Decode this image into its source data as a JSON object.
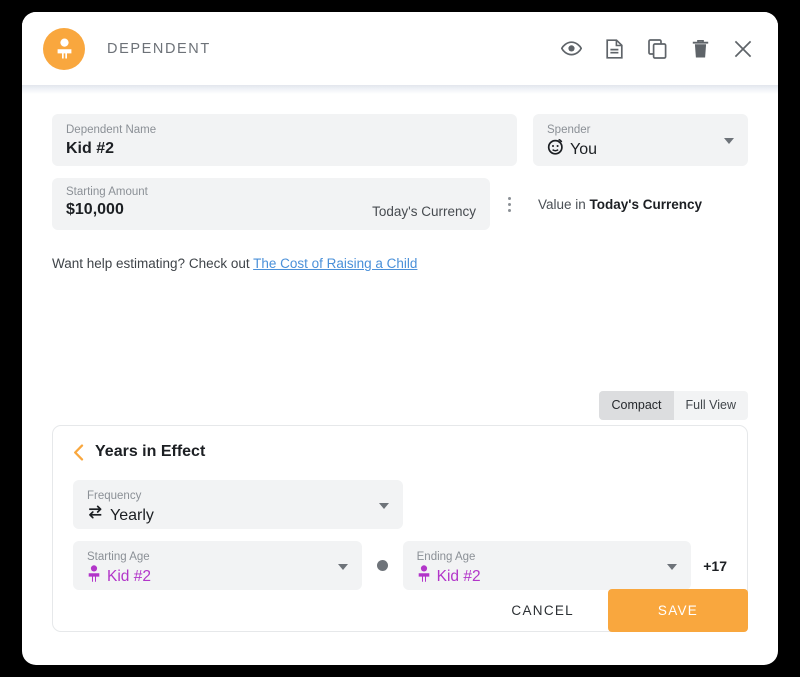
{
  "header": {
    "title": "DEPENDENT",
    "avatar_icon": "person-icon",
    "accent_color": "#f9a73e",
    "actions": [
      {
        "name": "preview",
        "icon": "eye-icon"
      },
      {
        "name": "notes",
        "icon": "document-icon"
      },
      {
        "name": "duplicate",
        "icon": "copy-icon"
      },
      {
        "name": "delete",
        "icon": "trash-icon"
      },
      {
        "name": "close",
        "icon": "close-icon"
      }
    ]
  },
  "form": {
    "dependent_name": {
      "label": "Dependent Name",
      "value": "Kid #2"
    },
    "spender": {
      "label": "Spender",
      "value": "You",
      "icon": "face-icon"
    },
    "starting_amount": {
      "label": "Starting Amount",
      "value": "$10,000",
      "currency_tag": "Today's Currency",
      "menu_icon": "kebab-menu-icon"
    },
    "value_in_prefix": "Value in ",
    "value_in_emphasis": "Today's Currency",
    "help_text": "Want help estimating? Check out ",
    "help_link": "The Cost of Raising a Child",
    "help_link_color": "#4a90d9"
  },
  "view_toggle": {
    "options": [
      "Compact",
      "Full View"
    ],
    "selected": "Compact"
  },
  "years_panel": {
    "title": "Years in Effect",
    "collapse_icon": "chevron-left-icon",
    "frequency": {
      "label": "Frequency",
      "value": "Yearly",
      "icon": "repeat-icon"
    },
    "starting_age": {
      "label": "Starting Age",
      "value": "Kid #2",
      "icon": "person-icon",
      "color": "#b235c9"
    },
    "ending_age": {
      "label": "Ending Age",
      "value": "Kid #2",
      "icon": "person-icon",
      "color": "#b235c9"
    },
    "ending_offset": "+17"
  },
  "footer": {
    "cancel_label": "CANCEL",
    "save_label": "SAVE",
    "save_color": "#f9a73e"
  }
}
